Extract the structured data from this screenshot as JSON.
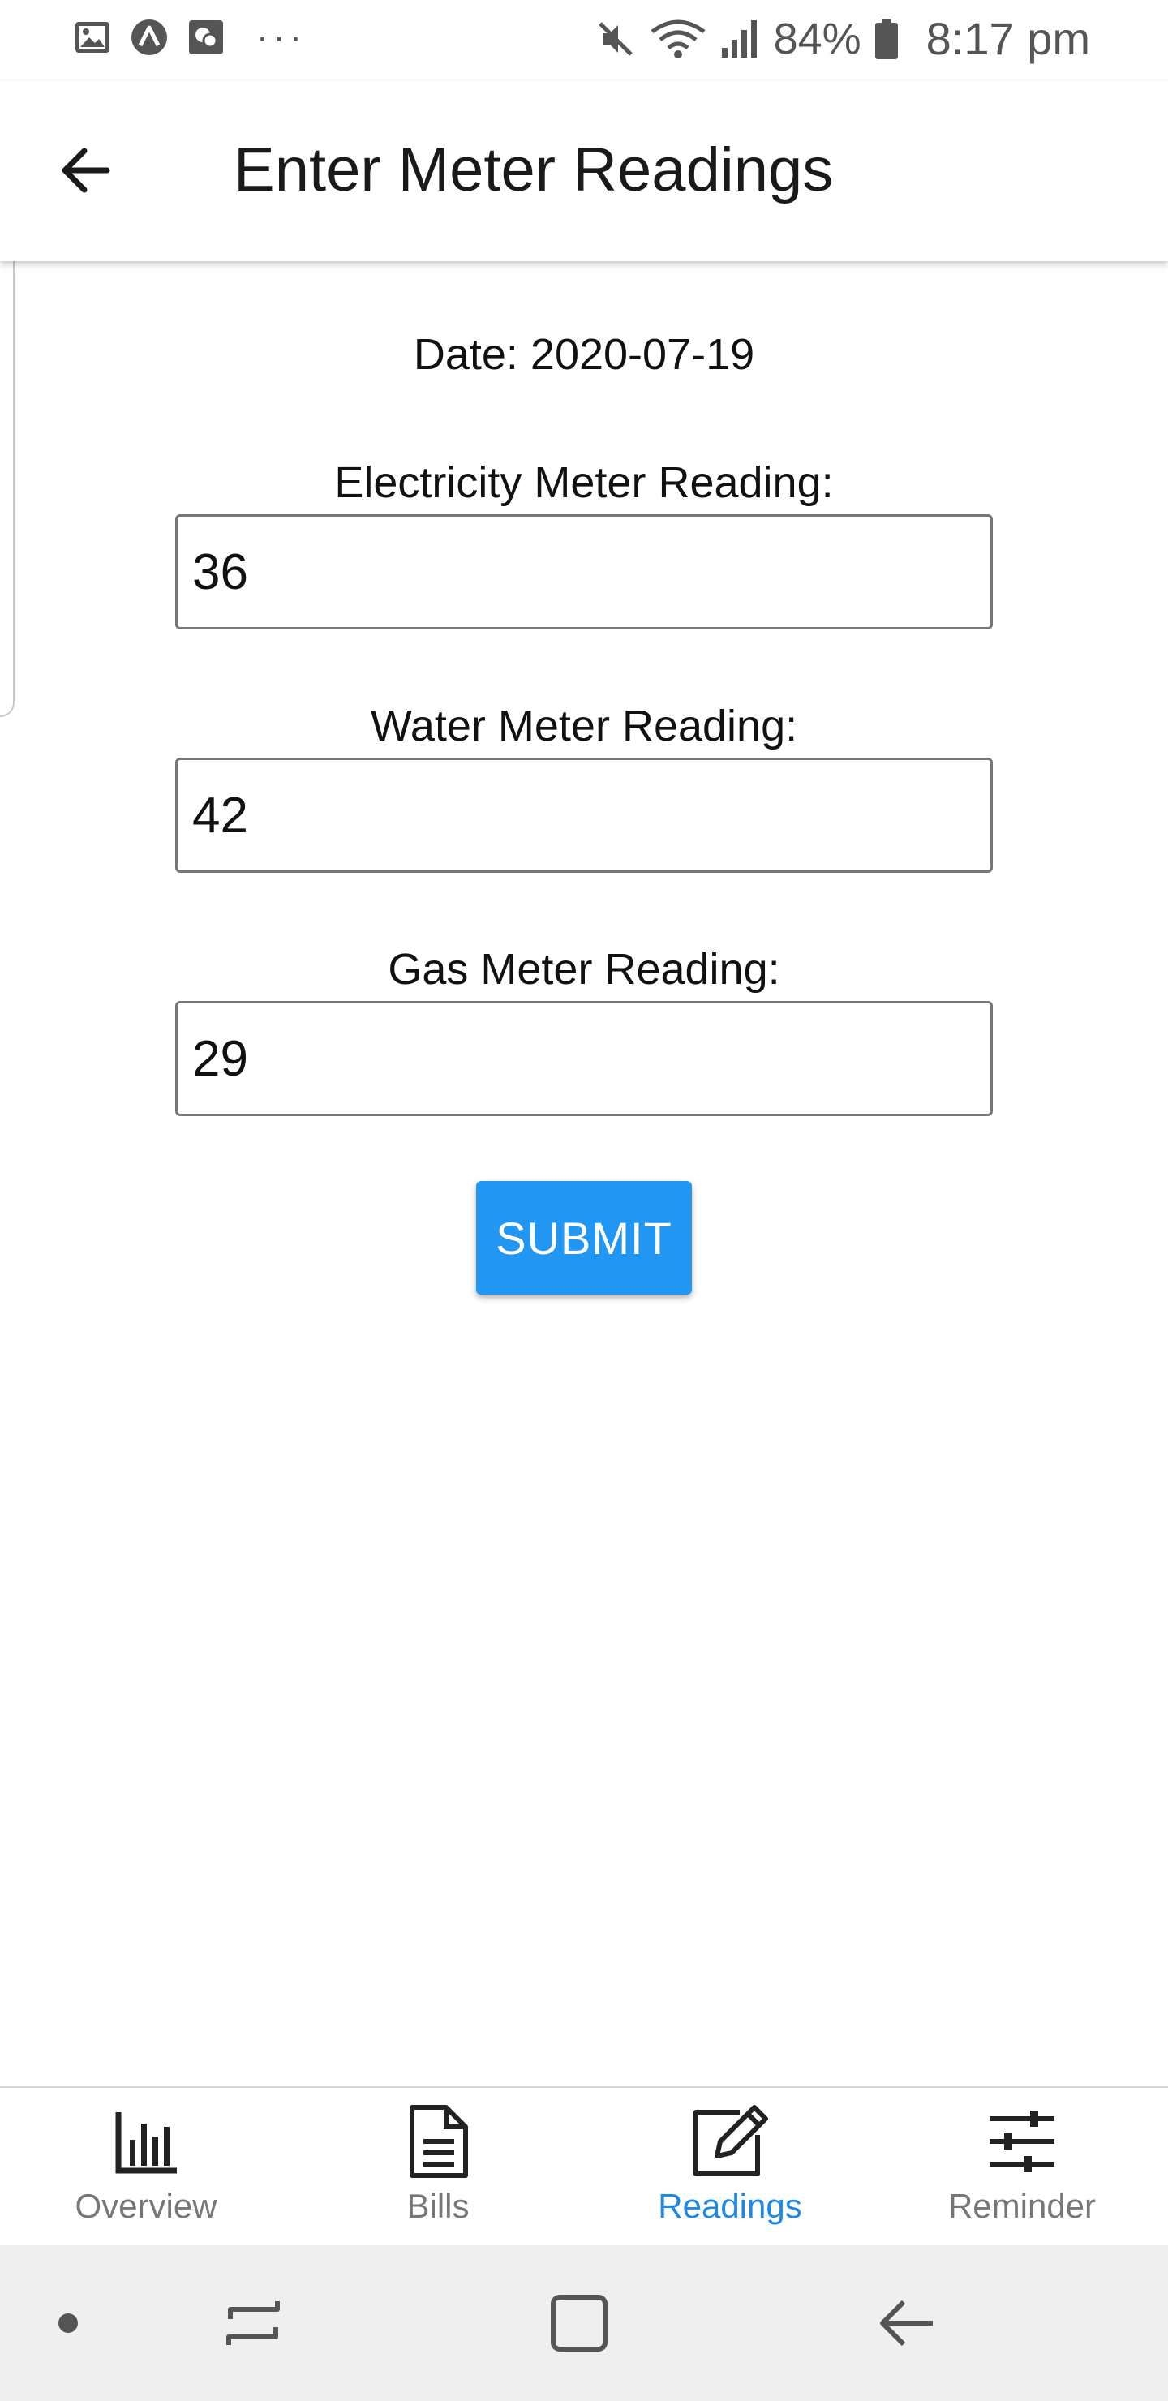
{
  "status_bar": {
    "battery_percent": "84%",
    "time": "8:17 pm",
    "left_icons": [
      "image-icon",
      "arc-icon",
      "chat-icon"
    ],
    "right_icons": [
      "mute-icon",
      "wifi-icon",
      "signal-icon",
      "battery-icon"
    ]
  },
  "app_bar": {
    "title": "Enter Meter Readings"
  },
  "form": {
    "date_text": "Date: 2020-07-19",
    "fields": [
      {
        "label": "Electricity Meter Reading:",
        "value": "36"
      },
      {
        "label": "Water Meter Reading:",
        "value": "42"
      },
      {
        "label": "Gas Meter Reading:",
        "value": "29"
      }
    ],
    "submit_label": "SUBMIT"
  },
  "bottom_nav": {
    "items": [
      {
        "label": "Overview",
        "icon": "bar-chart-icon",
        "active": false
      },
      {
        "label": "Bills",
        "icon": "document-icon",
        "active": false
      },
      {
        "label": "Readings",
        "icon": "edit-icon",
        "active": true
      },
      {
        "label": "Reminder",
        "icon": "sliders-icon",
        "active": false
      }
    ]
  },
  "colors": {
    "accent": "#2196f3",
    "active_nav": "#1e88e5",
    "inactive_nav": "#777777",
    "system_nav_bg": "#efefef"
  }
}
